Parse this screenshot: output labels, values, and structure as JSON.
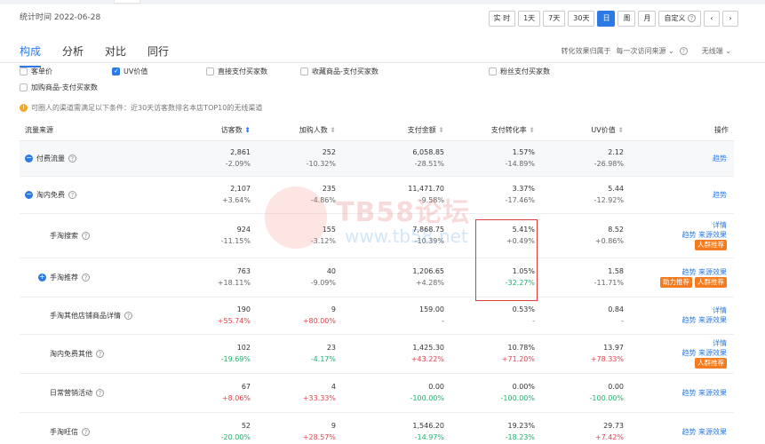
{
  "header": {
    "stat_time": "统计时间 2022-06-28"
  },
  "date_buttons": [
    {
      "label": "实 时",
      "active": false
    },
    {
      "label": "1天",
      "active": false
    },
    {
      "label": "7天",
      "active": false
    },
    {
      "label": "30天",
      "active": false
    },
    {
      "label": "日",
      "active": true
    },
    {
      "label": "周",
      "active": false
    },
    {
      "label": "月",
      "active": false
    },
    {
      "label": "自定义",
      "active": false
    }
  ],
  "nav": {
    "prev": "‹",
    "next": "›"
  },
  "tabs": [
    {
      "label": "构成",
      "active": true
    },
    {
      "label": "分析",
      "active": false
    },
    {
      "label": "对比",
      "active": false
    },
    {
      "label": "同行",
      "active": false
    }
  ],
  "attribution": {
    "label": "转化效果归属于",
    "value": "每一次访问来源",
    "device": "无线端"
  },
  "metrics": [
    {
      "label": "客单价",
      "checked": false
    },
    {
      "label": "UV价值",
      "checked": true
    },
    {
      "label": "直接支付买家数",
      "checked": false
    },
    {
      "label": "收藏商品-支付买家数",
      "checked": false
    },
    {
      "label": "粉丝支付买家数",
      "checked": false
    },
    {
      "label": "加购商品-支付买家数",
      "checked": false
    }
  ],
  "notice": "可圈人的渠道需满足以下条件：近30天访客数排名本店TOP10的无线渠道",
  "columns": {
    "source": "流量来源",
    "visitors": "访客数",
    "cart": "加购人数",
    "pay": "支付金额",
    "conv": "支付转化率",
    "uv": "UV价值",
    "ops": "操作"
  },
  "rows": [
    {
      "name": "付费流量",
      "type": "group",
      "icon": "minus",
      "visitors": [
        "2,861",
        "-2.09%"
      ],
      "cart": [
        "252",
        "-10.32%"
      ],
      "pay": [
        "6,058.85",
        "-28.51%"
      ],
      "conv": [
        "1.57%",
        "-14.89%"
      ],
      "uv": [
        "2.12",
        "-26.98%"
      ],
      "ops": [
        "趋势"
      ],
      "pills": []
    },
    {
      "name": "淘内免费",
      "type": "group2",
      "icon": "minus",
      "visitors": [
        "2,107",
        "+3.64%"
      ],
      "cart": [
        "235",
        "-4.86%"
      ],
      "pay": [
        "11,471.70",
        "-9.58%"
      ],
      "conv": [
        "3.37%",
        "-17.46%"
      ],
      "uv": [
        "5.44",
        "-12.92%"
      ],
      "ops": [
        "趋势"
      ],
      "pills": []
    },
    {
      "name": "手淘搜索",
      "type": "child",
      "icon": "",
      "visitors": [
        "924",
        "-11.15%"
      ],
      "cart": [
        "155",
        "-3.12%"
      ],
      "pay": [
        "7,868.75",
        "-10.39%"
      ],
      "conv": [
        "5.41%",
        "+0.49%"
      ],
      "uv": [
        "8.52",
        "+0.86%"
      ],
      "ops": [
        "详情",
        "趋势 来源效果"
      ],
      "pills": [
        "人群推荐"
      ]
    },
    {
      "name": "手淘推荐",
      "type": "child",
      "icon": "plus",
      "visitors": [
        "763",
        "+18.11%"
      ],
      "cart": [
        "40",
        "-9.09%"
      ],
      "pay": [
        "1,206.65",
        "+4.28%"
      ],
      "conv": [
        "1.05%",
        "-32.27%"
      ],
      "uv": [
        "1.58",
        "-11.71%"
      ],
      "ops": [
        "趋势 来源效果"
      ],
      "pills": [
        "助力推荐",
        "人群推荐"
      ]
    },
    {
      "name": "手淘其他店铺商品详情",
      "type": "child",
      "icon": "",
      "visitors": [
        "190",
        "+55.74%"
      ],
      "cart": [
        "9",
        "+80.00%"
      ],
      "pay": [
        "159.00",
        "-"
      ],
      "conv": [
        "0.53%",
        "-"
      ],
      "uv": [
        "0.84",
        "-"
      ],
      "ops": [
        "详情",
        "趋势 来源效果"
      ],
      "pills": []
    },
    {
      "name": "淘内免费其他",
      "type": "child",
      "icon": "",
      "visitors": [
        "102",
        "-19.69%"
      ],
      "cart": [
        "23",
        "-4.17%"
      ],
      "pay": [
        "1,425.30",
        "+43.22%"
      ],
      "conv": [
        "10.78%",
        "+71.20%"
      ],
      "uv": [
        "13.97",
        "+78.33%"
      ],
      "ops": [
        "详情",
        "趋势 来源效果"
      ],
      "pills": [
        "人群推荐"
      ]
    },
    {
      "name": "日常营销活动",
      "type": "child",
      "icon": "",
      "visitors": [
        "67",
        "+8.06%"
      ],
      "cart": [
        "4",
        "+33.33%"
      ],
      "pay": [
        "0.00",
        "-100.00%"
      ],
      "conv": [
        "0.00%",
        "-100.00%"
      ],
      "uv": [
        "0.00",
        "-100.00%"
      ],
      "ops": [
        "趋势 来源效果"
      ],
      "pills": []
    },
    {
      "name": "手淘旺信",
      "type": "child",
      "icon": "",
      "visitors": [
        "52",
        "-20.00%"
      ],
      "cart": [
        "9",
        "+28.57%"
      ],
      "pay": [
        "1,546.20",
        "-14.97%"
      ],
      "conv": [
        "19.23%",
        "-18.23%"
      ],
      "uv": [
        "29.73",
        "+7.42%"
      ],
      "ops": [
        "趋势 来源效果"
      ],
      "pills": []
    }
  ],
  "watermark": {
    "title": "TB58论坛",
    "url": "www.tb58.net"
  },
  "colors": {
    "accent": "#2c7be5",
    "positive": "#e5424b",
    "negative": "#1bb36a",
    "pill": "#f47b20",
    "highlight": "#e03a3a"
  }
}
